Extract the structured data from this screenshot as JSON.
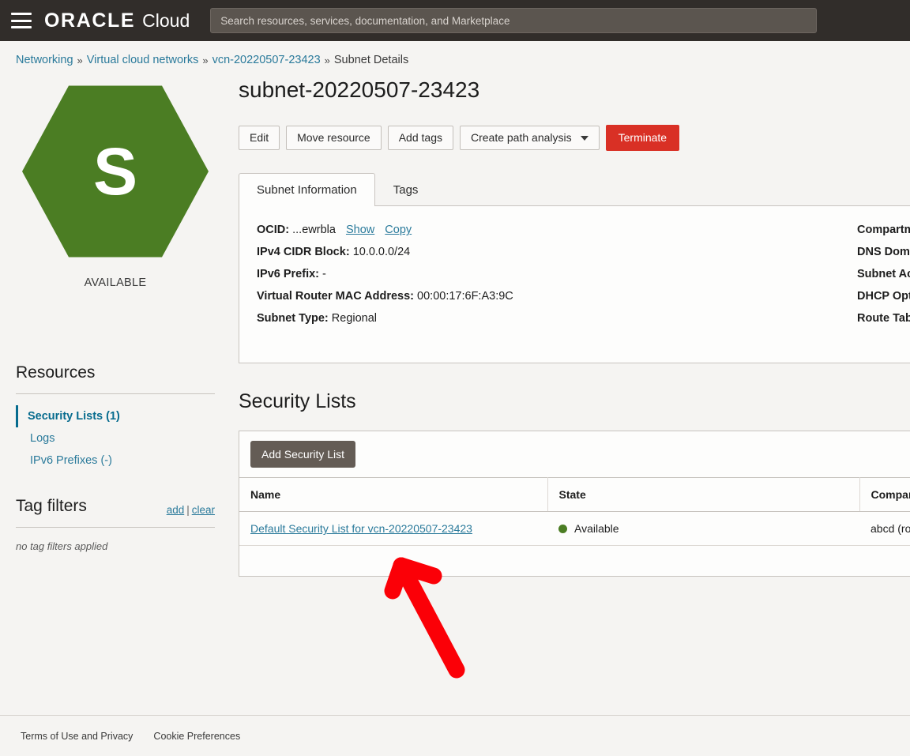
{
  "header": {
    "menu_icon": "hamburger-icon",
    "brand_oracle": "ORACLE",
    "brand_cloud": "Cloud",
    "search_placeholder": "Search resources, services, documentation, and Marketplace",
    "search_value": "",
    "bg_color": "#312d2a"
  },
  "breadcrumb": {
    "items": [
      {
        "label": "Networking",
        "link": true
      },
      {
        "label": "Virtual cloud networks",
        "link": true
      },
      {
        "label": "vcn-20220507-23423",
        "link": true
      },
      {
        "label": "Subnet Details",
        "link": false
      }
    ],
    "separator": "»",
    "link_color": "#2a7a9b"
  },
  "avatar": {
    "letter": "S",
    "status": "AVAILABLE",
    "color": "#4b7d23"
  },
  "resources": {
    "title": "Resources",
    "items": [
      {
        "label": "Security Lists (1)",
        "active": true
      },
      {
        "label": "Logs",
        "active": false
      },
      {
        "label": "IPv6 Prefixes (-)",
        "active": false
      }
    ]
  },
  "tag_filters": {
    "title": "Tag filters",
    "add_label": "add",
    "separator": "|",
    "clear_label": "clear",
    "empty_text": "no tag filters applied"
  },
  "main": {
    "page_title": "subnet-20220507-23423",
    "actions": [
      {
        "name": "edit-button",
        "label": "Edit",
        "style": "default"
      },
      {
        "name": "move-resource-button",
        "label": "Move resource",
        "style": "default"
      },
      {
        "name": "add-tags-button",
        "label": "Add tags",
        "style": "default"
      },
      {
        "name": "create-path-analysis-button",
        "label": "Create path analysis",
        "style": "dropdown"
      },
      {
        "name": "terminate-button",
        "label": "Terminate",
        "style": "danger"
      }
    ],
    "terminate_color": "#d93025",
    "tabs": [
      {
        "label": "Subnet Information",
        "active": true
      },
      {
        "label": "Tags",
        "active": false
      }
    ],
    "details_left": [
      {
        "key": "OCID:",
        "value": "...ewrbla",
        "show_label": "Show",
        "copy_label": "Copy"
      },
      {
        "key": "IPv4 CIDR Block:",
        "value": "10.0.0.0/24"
      },
      {
        "key": "IPv6 Prefix:",
        "value": "-"
      },
      {
        "key": "Virtual Router MAC Address:",
        "value": "00:00:17:6F:A3:9C"
      },
      {
        "key": "Subnet Type:",
        "value": "Regional"
      }
    ],
    "details_right": [
      {
        "key": "Compartment:",
        "value": ""
      },
      {
        "key": "DNS Domain Name:",
        "value": ""
      },
      {
        "key": "Subnet Access:",
        "value": ""
      },
      {
        "key": "DHCP Options:",
        "value": ""
      },
      {
        "key": "Route Table:",
        "value": ""
      }
    ]
  },
  "security_lists": {
    "section_title": "Security Lists",
    "add_button": "Add Security List",
    "columns": [
      "Name",
      "State",
      "Compartment"
    ],
    "rows": [
      {
        "name": "Default Security List for vcn-20220507-23423",
        "state": "Available",
        "state_color": "#4b7d23",
        "compartment": "abcd (root)"
      }
    ]
  },
  "footer": {
    "links": [
      "Terms of Use and Privacy",
      "Cookie Preferences"
    ]
  },
  "annotation": {
    "type": "red-arrow",
    "color": "#fb0007",
    "points_to": "security-list-name-link"
  }
}
